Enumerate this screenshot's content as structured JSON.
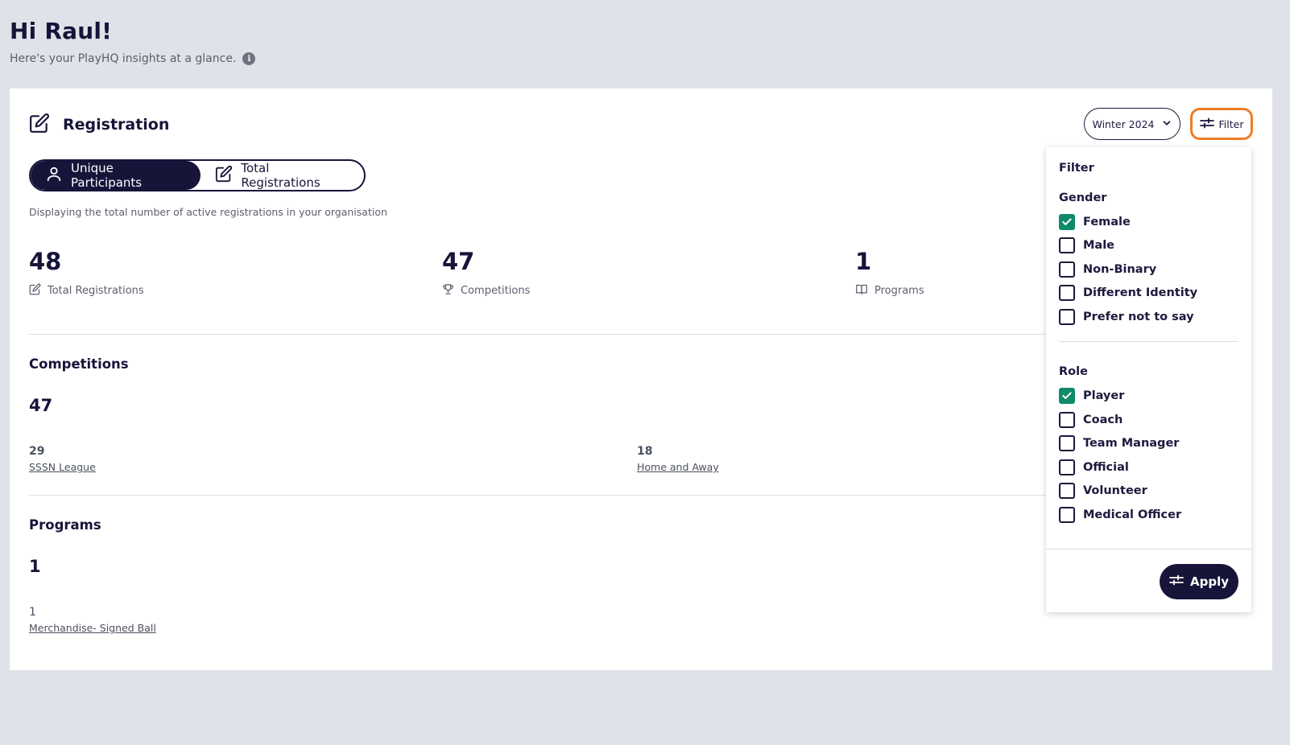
{
  "greeting": {
    "title": "Hi Raul!",
    "subtitle": "Here's your PlayHQ insights at a glance."
  },
  "card": {
    "title": "Registration",
    "season_select": "Winter 2024",
    "filter_label": "Filter",
    "toggle": {
      "active": "Unique Participants",
      "inactive": "Total Registrations"
    },
    "description": "Displaying the total number of active registrations in your organisation",
    "stats": [
      {
        "value": "48",
        "label": "Total Registrations",
        "icon": "edit-icon"
      },
      {
        "value": "47",
        "label": "Competitions",
        "icon": "trophy-icon"
      },
      {
        "value": "1",
        "label": "Programs",
        "icon": "book-icon"
      }
    ],
    "competitions": {
      "title": "Competitions",
      "total": "47",
      "items": [
        {
          "value": "29",
          "name": "SSSN League"
        },
        {
          "value": "18",
          "name": "Home and Away"
        }
      ]
    },
    "programs": {
      "title": "Programs",
      "total": "1",
      "items": [
        {
          "value": "1",
          "name": "Merchandise- Signed Ball"
        }
      ]
    }
  },
  "filter_panel": {
    "title": "Filter",
    "gender": {
      "label": "Gender",
      "options": [
        {
          "label": "Female",
          "checked": true
        },
        {
          "label": "Male",
          "checked": false
        },
        {
          "label": "Non-Binary",
          "checked": false
        },
        {
          "label": "Different Identity",
          "checked": false
        },
        {
          "label": "Prefer not to say",
          "checked": false
        }
      ]
    },
    "role": {
      "label": "Role",
      "options": [
        {
          "label": "Player",
          "checked": true
        },
        {
          "label": "Coach",
          "checked": false
        },
        {
          "label": "Team Manager",
          "checked": false
        },
        {
          "label": "Official",
          "checked": false
        },
        {
          "label": "Volunteer",
          "checked": false
        },
        {
          "label": "Medical Officer",
          "checked": false
        }
      ]
    },
    "apply_label": "Apply"
  },
  "colors": {
    "navy": "#17143a",
    "check_green": "#0e8a6a",
    "focus_orange": "#f07c24",
    "background": "#dfe2e8"
  }
}
